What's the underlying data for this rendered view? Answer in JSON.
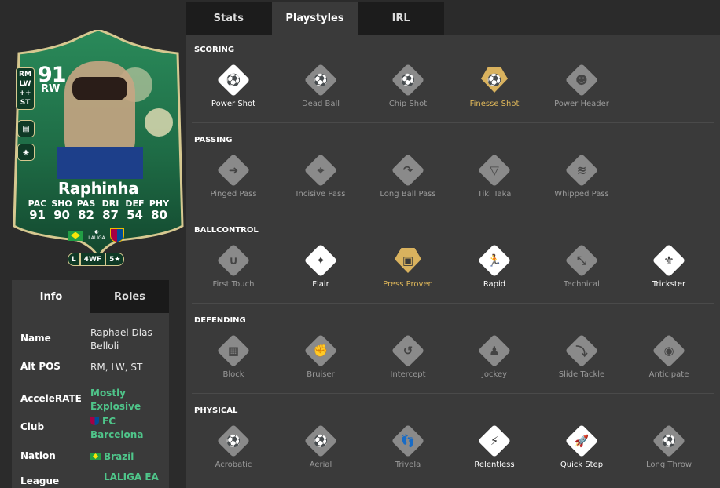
{
  "card": {
    "rating": "91",
    "position": "RW",
    "alt_positions": [
      "RM",
      "LW",
      "++",
      "ST"
    ],
    "name": "Raphinha",
    "stat_labels": [
      "PAC",
      "SHO",
      "PAS",
      "DRI",
      "DEF",
      "PHY"
    ],
    "stat_values": [
      "91",
      "90",
      "82",
      "87",
      "54",
      "80"
    ],
    "league_logo_text": "LALIGA",
    "traits": [
      "L",
      "4WF",
      "5★"
    ]
  },
  "info": {
    "tabs": [
      "Info",
      "Roles"
    ],
    "rows": [
      {
        "key": "Name",
        "value": "Raphael Dias Belloli"
      },
      {
        "key": "Alt POS",
        "value": "RM, LW, ST"
      },
      {
        "key": "AcceleRATE",
        "value": "Mostly Explosive"
      },
      {
        "key": "Club",
        "value": "FC Barcelona"
      },
      {
        "key": "Nation",
        "value": "Brazil"
      },
      {
        "key": "League",
        "value": "LALIGA EA"
      }
    ]
  },
  "tabs": [
    "Stats",
    "Playstyles",
    "IRL"
  ],
  "sections": [
    {
      "title": "SCORING",
      "items": [
        {
          "label": "Power Shot",
          "state": "on",
          "icon": "power-shot-icon",
          "glyph": "⚽"
        },
        {
          "label": "Dead Ball",
          "state": "off",
          "icon": "dead-ball-icon",
          "glyph": "⚽"
        },
        {
          "label": "Chip Shot",
          "state": "off",
          "icon": "chip-shot-icon",
          "glyph": "⚽"
        },
        {
          "label": "Finesse Shot",
          "state": "gold",
          "icon": "finesse-shot-icon",
          "glyph": "⚽"
        },
        {
          "label": "Power Header",
          "state": "off",
          "icon": "power-header-icon",
          "glyph": "☻"
        }
      ]
    },
    {
      "title": "PASSING",
      "items": [
        {
          "label": "Pinged Pass",
          "state": "off",
          "icon": "pinged-pass-icon",
          "glyph": "➜"
        },
        {
          "label": "Incisive Pass",
          "state": "off",
          "icon": "incisive-pass-icon",
          "glyph": "⌖"
        },
        {
          "label": "Long Ball Pass",
          "state": "off",
          "icon": "long-ball-pass-icon",
          "glyph": "↷"
        },
        {
          "label": "Tiki Taka",
          "state": "off",
          "icon": "tiki-taka-icon",
          "glyph": "▽"
        },
        {
          "label": "Whipped Pass",
          "state": "off",
          "icon": "whipped-pass-icon",
          "glyph": "≋"
        }
      ]
    },
    {
      "title": "BALLCONTROL",
      "items": [
        {
          "label": "First Touch",
          "state": "off",
          "icon": "first-touch-icon",
          "glyph": "∪"
        },
        {
          "label": "Flair",
          "state": "on",
          "icon": "flair-icon",
          "glyph": "✦"
        },
        {
          "label": "Press Proven",
          "state": "gold",
          "icon": "press-proven-icon",
          "glyph": "▣"
        },
        {
          "label": "Rapid",
          "state": "on",
          "icon": "rapid-icon",
          "glyph": "🏃"
        },
        {
          "label": "Technical",
          "state": "off",
          "icon": "technical-icon",
          "glyph": "⤡"
        },
        {
          "label": "Trickster",
          "state": "on",
          "icon": "trickster-icon",
          "glyph": "⚜"
        }
      ]
    },
    {
      "title": "DEFENDING",
      "items": [
        {
          "label": "Block",
          "state": "off",
          "icon": "block-icon",
          "glyph": "▦"
        },
        {
          "label": "Bruiser",
          "state": "off",
          "icon": "bruiser-icon",
          "glyph": "✊"
        },
        {
          "label": "Intercept",
          "state": "off",
          "icon": "intercept-icon",
          "glyph": "↺"
        },
        {
          "label": "Jockey",
          "state": "off",
          "icon": "jockey-icon",
          "glyph": "♟"
        },
        {
          "label": "Slide Tackle",
          "state": "off",
          "icon": "slide-tackle-icon",
          "glyph": "⤵"
        },
        {
          "label": "Anticipate",
          "state": "off",
          "icon": "anticipate-icon",
          "glyph": "◉"
        }
      ]
    },
    {
      "title": "PHYSICAL",
      "items": [
        {
          "label": "Acrobatic",
          "state": "off",
          "icon": "acrobatic-icon",
          "glyph": "⚽"
        },
        {
          "label": "Aerial",
          "state": "off",
          "icon": "aerial-icon",
          "glyph": "⚽"
        },
        {
          "label": "Trivela",
          "state": "off",
          "icon": "trivela-icon",
          "glyph": "👣"
        },
        {
          "label": "Relentless",
          "state": "on",
          "icon": "relentless-icon",
          "glyph": "⚡"
        },
        {
          "label": "Quick Step",
          "state": "on",
          "icon": "quick-step-icon",
          "glyph": "🚀"
        },
        {
          "label": "Long Throw",
          "state": "off",
          "icon": "long-throw-icon",
          "glyph": "⚽"
        }
      ]
    }
  ],
  "colors": {
    "background": "#2b2b2b",
    "panel": "#3a3a3a",
    "accent_green": "#4fc58a",
    "gold": "#e0b85a",
    "card_green": "#1e6b45"
  }
}
